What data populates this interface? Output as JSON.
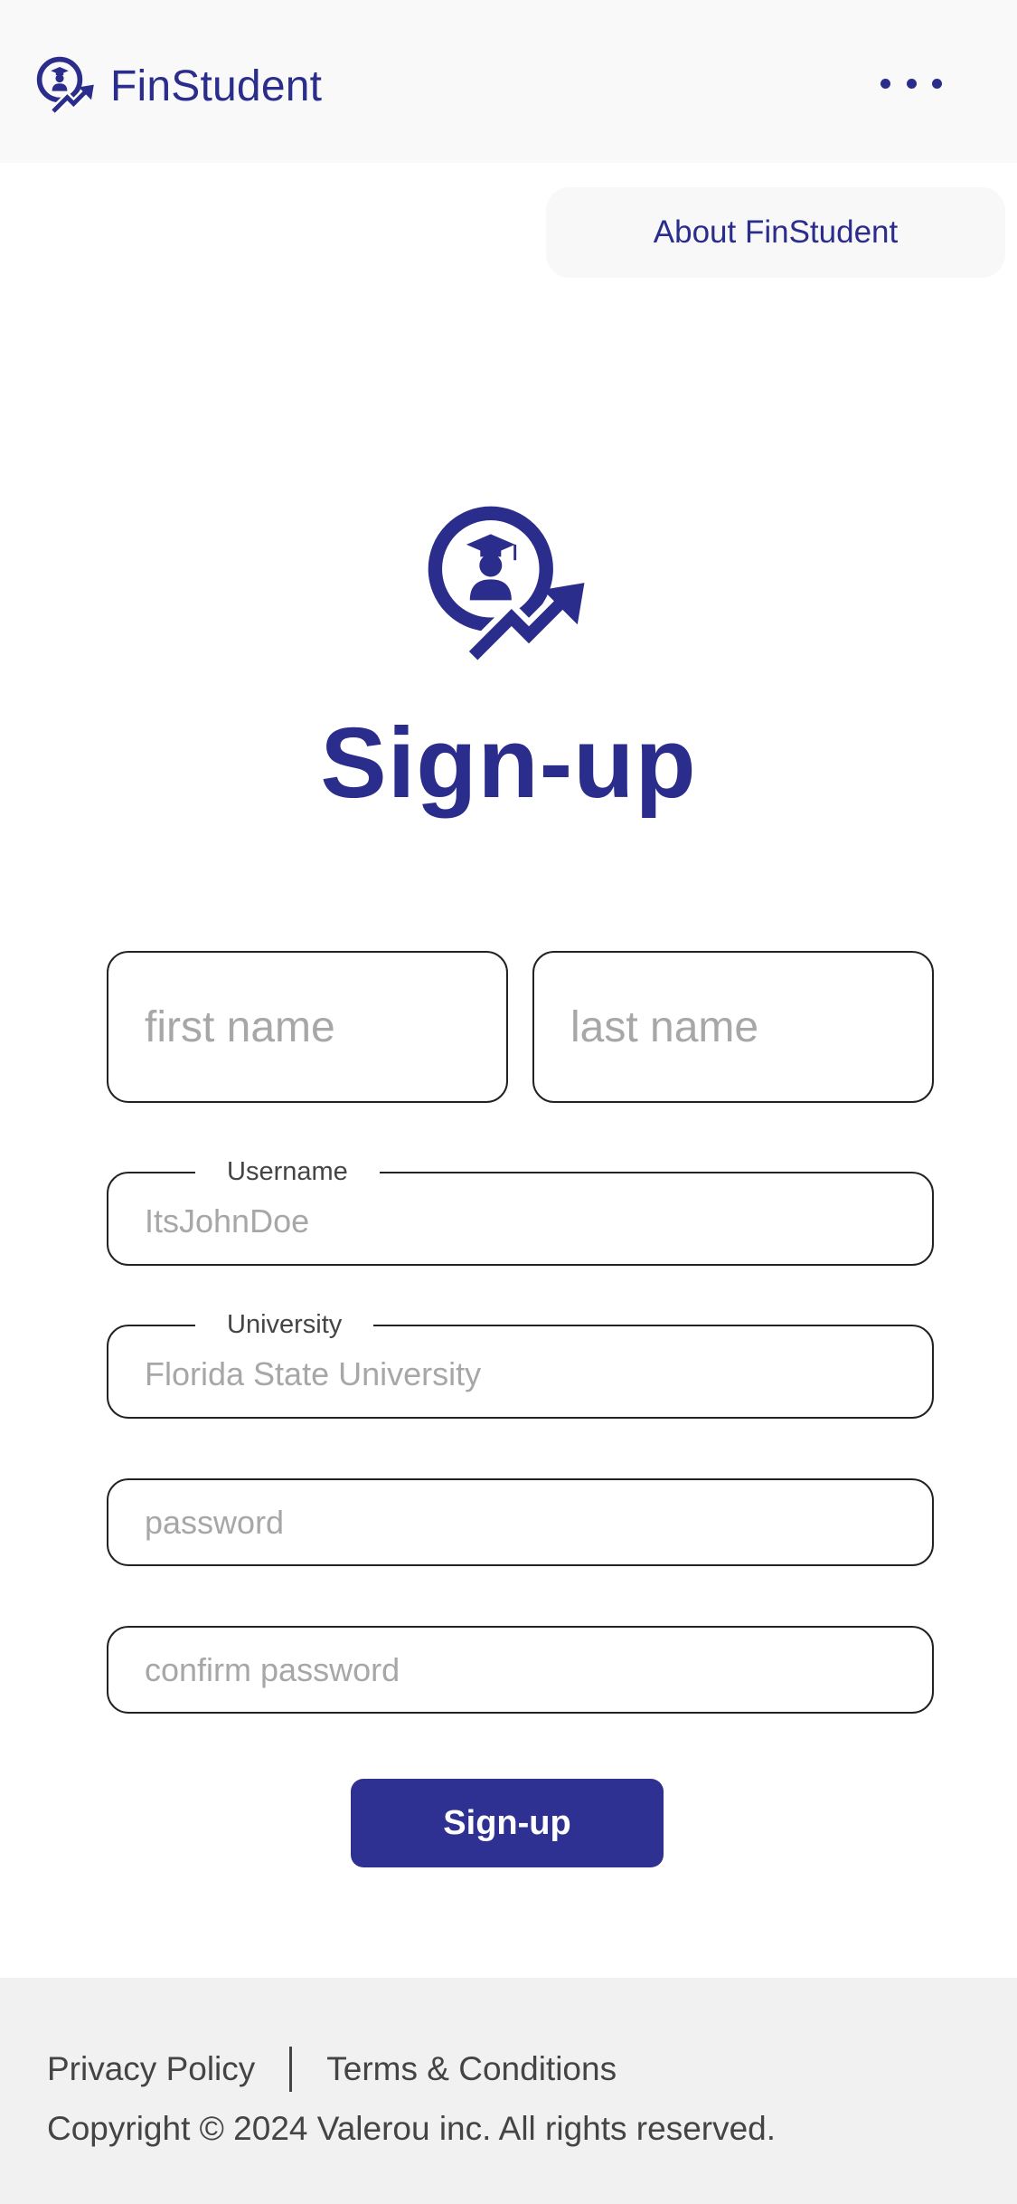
{
  "header": {
    "brand_name": "FinStudent",
    "logo_icon": "graduate-growth-logo",
    "menu_icon": "more-horizontal-icon"
  },
  "nav": {
    "about_label": "About FinStudent"
  },
  "main": {
    "title": "Sign-up"
  },
  "form": {
    "first_name_placeholder": "first name",
    "last_name_placeholder": "last name",
    "username_label": "Username",
    "username_placeholder": "ItsJohnDoe",
    "university_label": "University",
    "university_placeholder": "Florida State University",
    "password_placeholder": "password",
    "confirm_password_placeholder": "confirm password",
    "submit_label": "Sign-up"
  },
  "footer": {
    "privacy_label": "Privacy Policy",
    "terms_label": "Terms & Conditions",
    "copyright": "Copyright © 2024 Valerou inc. All rights reserved."
  },
  "colors": {
    "brand": "#2b2d8c",
    "button": "#2e3192",
    "header_bg": "#f9f9f9",
    "footer_bg": "#f1f1f1"
  }
}
